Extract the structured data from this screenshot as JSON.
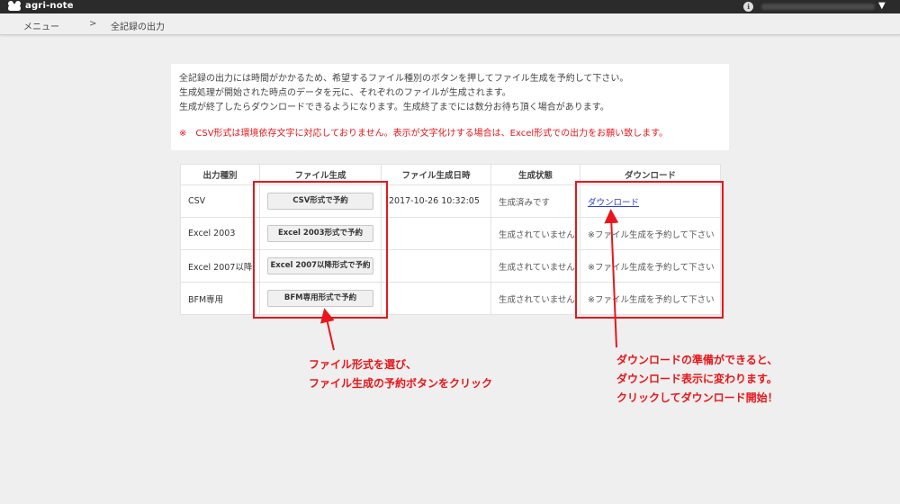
{
  "topbar": {
    "app_name": "agri-note",
    "user_icon_glyph": "ℹ",
    "caret": "▼"
  },
  "breadcrumb": {
    "menu": "メニュー",
    "separator": ">",
    "current": "全記録の出力"
  },
  "notice": {
    "lines": [
      "全記録の出力には時間がかかるため、希望するファイル種別のボタンを押してファイル生成を予約して下さい。",
      "生成処理が開始された時点のデータを元に、それぞれのファイルが生成されます。",
      "生成が終了したらダウンロードできるようになります。生成終了までには数分お待ち頂く場合があります。"
    ],
    "warning": "※　CSV形式は環境依存文字に対応しておりません。表示が文字化けする場合は、Excel形式での出力をお願い致します。"
  },
  "table": {
    "headers": [
      "出力種別",
      "ファイル生成",
      "ファイル生成日時",
      "生成状態",
      "ダウンロード"
    ],
    "rows": [
      {
        "type": "CSV",
        "button": "CSV形式で予約",
        "datetime": "2017-10-26 10:32:05",
        "status": "生成済みです",
        "download": "ダウンロード"
      },
      {
        "type": "Excel 2003",
        "button": "Excel 2003形式で予約",
        "datetime": "",
        "status": "生成されていません",
        "download": "※ファイル生成を予約して下さい"
      },
      {
        "type": "Excel 2007以降",
        "button": "Excel 2007以降形式で予約",
        "datetime": "",
        "status": "生成されていません",
        "download": "※ファイル生成を予約して下さい"
      },
      {
        "type": "BFM専用",
        "button": "BFM専用形式で予約",
        "datetime": "",
        "status": "生成されていません",
        "download": "※ファイル生成を予約して下さい"
      }
    ]
  },
  "annotations": {
    "left": [
      "ファイル形式を選び、",
      "ファイル生成の予約ボタンをクリック"
    ],
    "right": [
      "ダウンロードの準備ができると、",
      "ダウンロード表示に変わります。",
      "クリックしてダウンロード開始！"
    ]
  },
  "colors": {
    "accent_red": "#e8161b",
    "link_blue": "#2a3fd6",
    "topbar": "#2b2b2b"
  }
}
